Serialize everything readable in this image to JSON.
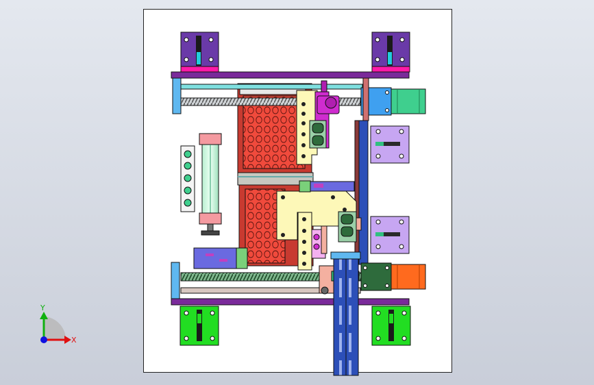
{
  "app": {
    "view": "cad-3d-viewport",
    "background_top": "#e4e8ef",
    "background_bottom": "#c9ced9"
  },
  "triad": {
    "x_label": "X",
    "y_label": "Y",
    "x_color": "#e01010",
    "y_color": "#10b010",
    "z_color": "#1010e0"
  },
  "colors": {
    "bracket_purple": "#6a3aa8",
    "bracket_green": "#22dd22",
    "rail_purple": "#7a2a9a",
    "screw_green": "#2e6b3c",
    "cells_red": "#f04a3c",
    "motor_teal": "#3fcf8e",
    "motor_orange": "#ff6a1e",
    "slide_blue": "#2c4fb8",
    "lilac": "#c7a6f2",
    "magenta": "#cf2ccf",
    "cream": "#fdf8b8",
    "cylinder_pink": "#f49aa0"
  }
}
